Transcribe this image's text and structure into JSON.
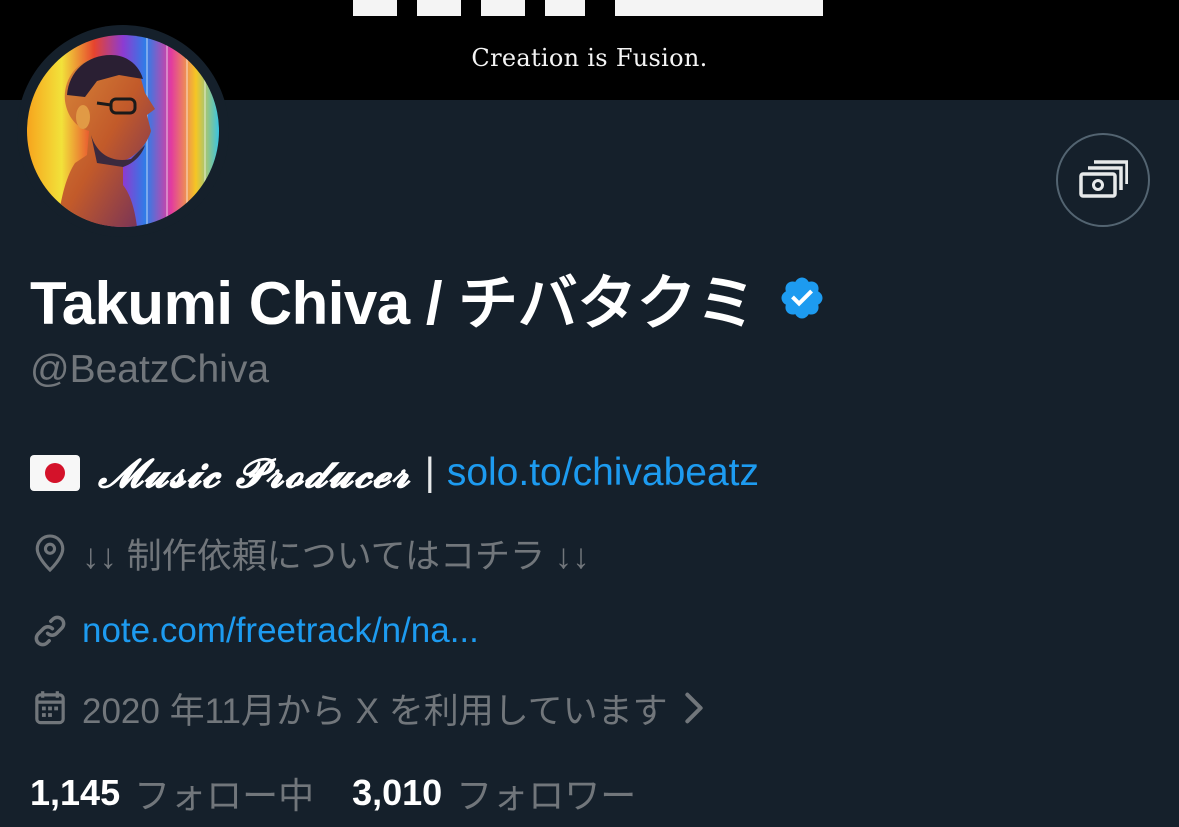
{
  "banner": {
    "tagline": "Creation is Fusion."
  },
  "profile": {
    "display_name": "Takumi Chiva / チバタクミ",
    "handle": "@BeatzChiva",
    "verified": true,
    "avatar_icon": "avatar-portrait",
    "action_icon": "money-icon"
  },
  "bio": {
    "flag_icon": "japan-flag-icon",
    "script_text": "𝓜𝓾𝓼𝓲𝓬 𝓟𝓻𝓸𝓭𝓾𝓬𝓮𝓻",
    "separator": "|",
    "link": "solo.to/chivabeatz"
  },
  "meta": {
    "location": "↓↓ 制作依頼についてはコチラ ↓↓",
    "website": "note.com/freetrack/n/na...",
    "joined": "2020 年11月から X を利用しています"
  },
  "stats": {
    "following_count": "1,145",
    "following_label": "フォロー中",
    "followers_count": "3,010",
    "followers_label": "フォロワー"
  },
  "colors": {
    "background": "#15202b",
    "banner": "#000000",
    "accent": "#1d9bf0",
    "secondary_text": "#71767b",
    "primary_text": "#ffffff"
  }
}
